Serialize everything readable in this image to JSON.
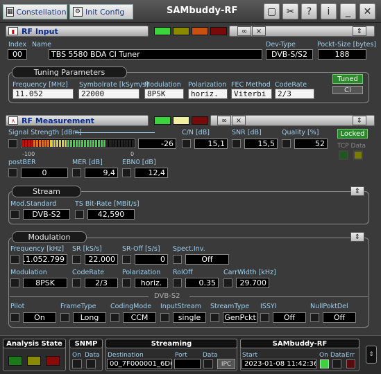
{
  "window": {
    "title": "SAMbuddy-RF"
  },
  "toolbar": {
    "tab_constellation": "Constellation",
    "tab_init_config": "Init Config"
  },
  "rf_input": {
    "title": "RF Input",
    "index_label": "Index",
    "index": "00",
    "name_label": "Name",
    "name": "TBS 5580 BDA CI Tuner",
    "devtype_label": "Dev-Type",
    "devtype": "DVB-S/S2",
    "pktsize_label": "Pockt-Size [bytes]",
    "pktsize": "188",
    "tuning": {
      "title": "Tuning Parameters",
      "freq_label": "Frequency [MHz]",
      "freq": "11.052",
      "sr_label": "Symbolrate [kSym/s]",
      "sr": "22000",
      "mod_label": "Modulation",
      "mod": "8PSK",
      "pol_label": "Polarization",
      "pol": "horiz.",
      "fec_label": "FEC Method",
      "fec": "Viterbi",
      "cr_label": "CodeRate",
      "cr": "2/3",
      "tuned": "Tuned",
      "ci": "CI"
    }
  },
  "rf_measurement": {
    "title": "RF Measurement",
    "ss_label": "Signal Strength [dBm]",
    "ss_min": "-100",
    "ss_max": "0",
    "ss": "-26",
    "ss_level": 0.74,
    "cn_label": "C/N [dB]",
    "cn": "15,1",
    "snr_label": "SNR [dB]",
    "snr": "15,5",
    "quality_label": "Quality [%]",
    "quality": "52",
    "locked": "Locked",
    "tcp_label": "TCP Data",
    "postber_label": "postBER",
    "postber": "0",
    "mer_label": "MER [dB]",
    "mer": "9,4",
    "ebn0_label": "EBN0 [dB]",
    "ebn0": "12,4"
  },
  "stream": {
    "title": "Stream",
    "modstd_label": "Mod.Standard",
    "modstd": "DVB-S2",
    "bitrate_label": "TS Bit-Rate [MBit/s]",
    "bitrate": "42,590"
  },
  "modulation": {
    "title": "Modulation",
    "freq_label": "Frequency [kHz]",
    "freq": "11.052.799",
    "sr_label": "SR [kS/s]",
    "sr": "22.000",
    "sroff_label": "SR-Off [S/s]",
    "sroff": "0",
    "spect_label": "Spect.Inv.",
    "spect": "Off",
    "mod_label": "Modulation",
    "mod": "8PSK",
    "cr_label": "CodeRate",
    "cr": "2/3",
    "pol_label": "Polarization",
    "pol": "horiz.",
    "rolloff_label": "RolOff",
    "rolloff": "0.35",
    "carrwidth_label": "CarrWidth [kHz]",
    "carrwidth": "29.700",
    "dvbs2_title": "DVB-S2",
    "pilot_label": "Pilot",
    "pilot": "On",
    "frametype_label": "FrameType",
    "frametype": "Long",
    "codingmode_label": "CodingMode",
    "codingmode": "CCM",
    "inputstream_label": "InputStream",
    "inputstream": "single",
    "streamtype_label": "StreamType",
    "streamtype": "GenPckt",
    "issyi_label": "ISSYI",
    "issyi": "Off",
    "nullpkt_label": "NullPoktDel",
    "nullpkt": "Off"
  },
  "status": {
    "analysis_title": "Analysis State",
    "snmp_title": "SNMP",
    "snmp_on": "On",
    "snmp_data": "Data",
    "streaming_title": "Streaming",
    "dest_label": "Destination",
    "dest": "00_7F000001_6D6",
    "port_label": "Port",
    "data_label": "Data",
    "ipc": "IPC",
    "sambuddy_title": "SAMbuddy-RF",
    "start_label": "Start",
    "start": "2023-01-08 11:42:36",
    "on_label": "On",
    "data2_label": "Data",
    "err_label": "Err"
  },
  "colors": {
    "led_green": "#3cd43c",
    "led_yellow": "#c8c800",
    "led_red": "#c01010",
    "label_blue": "#9ed0f0"
  }
}
